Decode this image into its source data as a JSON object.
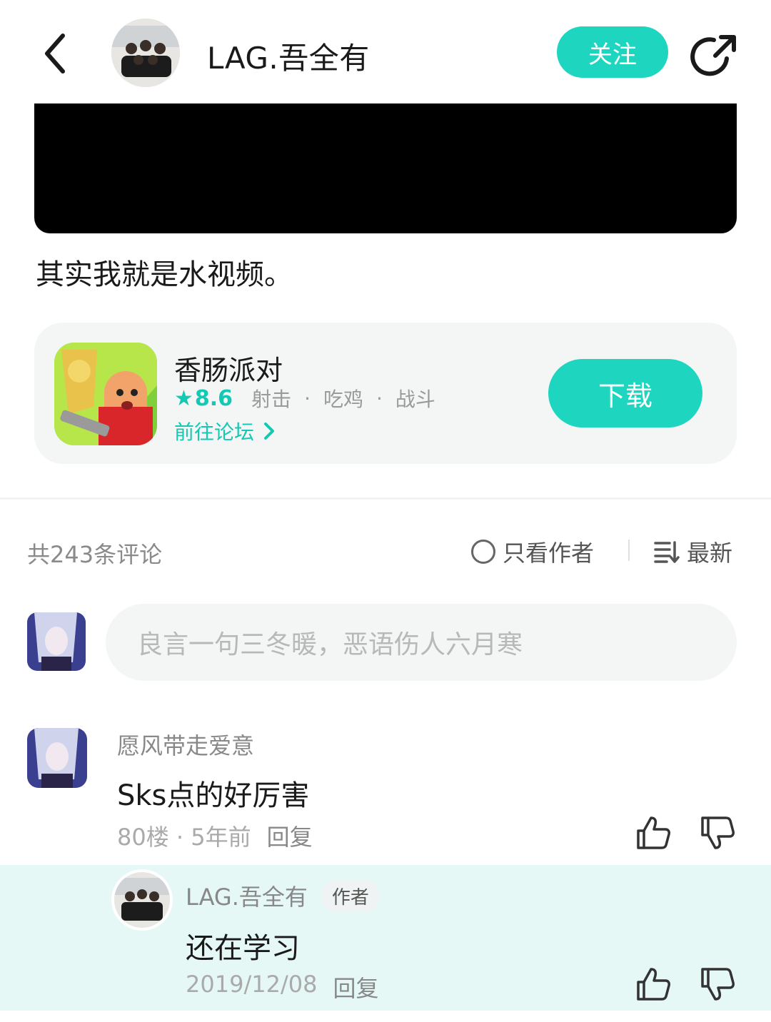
{
  "header": {
    "username": "LAG.吾全有",
    "follow_label": "关注"
  },
  "post": {
    "text": "其实我就是水视频。"
  },
  "game": {
    "title": "香肠派对",
    "rating": "8.6",
    "tags": [
      "射击",
      "吃鸡",
      "战斗"
    ],
    "forum_link": "前往论坛",
    "download_label": "下载"
  },
  "comments_bar": {
    "count_label": "共243条评论",
    "author_only_label": "只看作者",
    "sort_label": "最新"
  },
  "composer": {
    "placeholder": "良言一句三冬暖，恶语伤人六月寒"
  },
  "comment": {
    "name": "愿风带走爱意",
    "text": "Sks点的好厉害",
    "meta": "80楼 · 5年前",
    "reply_label": "回复"
  },
  "author_reply": {
    "name": "LAG.吾全有",
    "badge": "作者",
    "text": "还在学习",
    "date": "2019/12/08",
    "reply_label": "回复"
  },
  "colors": {
    "accent": "#1ed6c0",
    "reply_bg": "#e5f8f5"
  },
  "icons": [
    "back-arrow-icon",
    "share-icon",
    "star-icon",
    "chevron-right-icon",
    "sort-icon",
    "thumbs-up-icon",
    "thumbs-down-icon"
  ]
}
